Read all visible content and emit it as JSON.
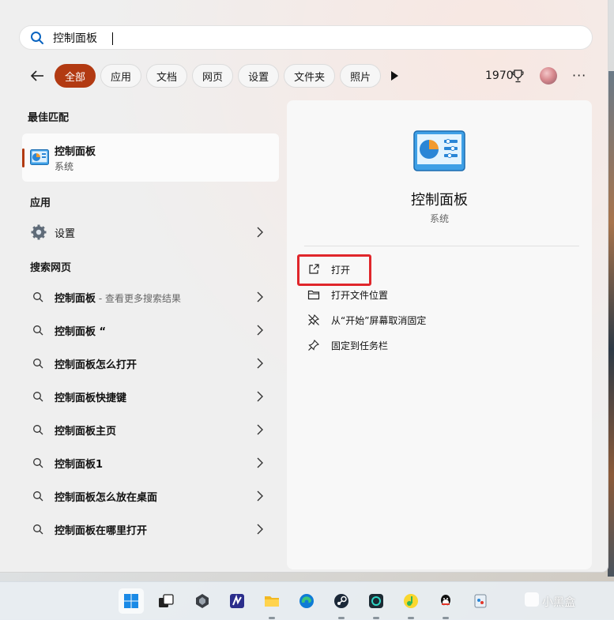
{
  "search": {
    "value": "控制面板"
  },
  "filters": {
    "chips": [
      {
        "label": "全部",
        "active": true
      },
      {
        "label": "应用"
      },
      {
        "label": "文档"
      },
      {
        "label": "网页"
      },
      {
        "label": "设置"
      },
      {
        "label": "文件夹"
      },
      {
        "label": "照片"
      }
    ],
    "points": "1970"
  },
  "left": {
    "best_match_title": "最佳匹配",
    "best_match": {
      "title": "控制面板",
      "subtitle": "系统",
      "icon": "control-panel-icon"
    },
    "apps_title": "应用",
    "apps": [
      {
        "label": "设置",
        "icon": "gear-icon"
      }
    ],
    "web_title": "搜索网页",
    "web_results": [
      {
        "bold": "控制面板",
        "rest": "",
        "hint": " - 查看更多搜索结果"
      },
      {
        "bold": "控制面板",
        "rest": " “",
        "hint": ""
      },
      {
        "bold": "控制面板",
        "rest": "怎么打开",
        "hint": ""
      },
      {
        "bold": "控制面板",
        "rest": "快捷键",
        "hint": ""
      },
      {
        "bold": "控制面板",
        "rest": "主页",
        "hint": ""
      },
      {
        "bold": "控制面板",
        "rest": "1",
        "hint": ""
      },
      {
        "bold": "控制面板",
        "rest": "怎么放在桌面",
        "hint": ""
      },
      {
        "bold": "控制面板",
        "rest": "在哪里打开",
        "hint": ""
      }
    ]
  },
  "preview": {
    "title": "控制面板",
    "subtitle": "系统",
    "actions": [
      {
        "label": "打开",
        "icon": "open-external-icon"
      },
      {
        "label": "打开文件位置",
        "icon": "folder-icon"
      },
      {
        "label": "从“开始”屏幕取消固定",
        "icon": "unpin-icon"
      },
      {
        "label": "固定到任务栏",
        "icon": "pin-icon"
      }
    ]
  },
  "taskbar": {
    "icons": [
      "windows-start-icon",
      "task-view-icon",
      "app-icon",
      "visual-studio-icon",
      "file-explorer-icon",
      "edge-icon",
      "steam-icon",
      "app-ring-icon",
      "qq-music-icon",
      "qq-icon",
      "paint-icon"
    ]
  },
  "watermark": "小黑盒",
  "colors": {
    "accent": "#b23a12",
    "highlight": "#e0262b"
  }
}
